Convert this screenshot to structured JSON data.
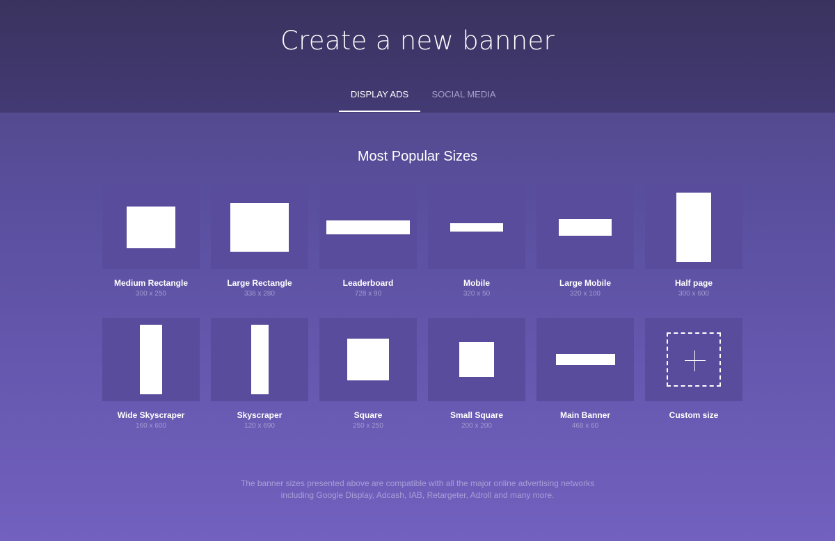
{
  "header": {
    "title": "Create a new banner",
    "tabs": [
      {
        "label": "DISPLAY ADS",
        "active": true
      },
      {
        "label": "SOCIAL MEDIA",
        "active": false
      }
    ]
  },
  "section": {
    "title": "Most Popular Sizes"
  },
  "sizes": [
    {
      "name": "Medium Rectangle",
      "dims": "300 x 250"
    },
    {
      "name": "Large Rectangle",
      "dims": "336 x 280"
    },
    {
      "name": "Leaderboard",
      "dims": "728 x 90"
    },
    {
      "name": "Mobile",
      "dims": "320 x 50"
    },
    {
      "name": "Large Mobile",
      "dims": "320 x 100"
    },
    {
      "name": "Half page",
      "dims": "300 x 600"
    },
    {
      "name": "Wide Skyscraper",
      "dims": "160 x 600"
    },
    {
      "name": "Skyscraper",
      "dims": "120 x 690"
    },
    {
      "name": "Square",
      "dims": "250 x 250"
    },
    {
      "name": "Small Square",
      "dims": "200 x 200"
    },
    {
      "name": "Main Banner",
      "dims": "468 x 60"
    },
    {
      "name": "Custom size"
    }
  ],
  "footer": {
    "line1": "The banner sizes presented above are compatible with all the major online advertising networks",
    "line2": "including Google Display, Adcash, IAB, Retargeter, Adroll and many more."
  },
  "colors": {
    "header_bg": "#3a335e",
    "page_bg": "#7261bf",
    "card_bg": "#5a4c9c",
    "accent": "#ffffff"
  },
  "icons": [
    "plus-icon"
  ]
}
